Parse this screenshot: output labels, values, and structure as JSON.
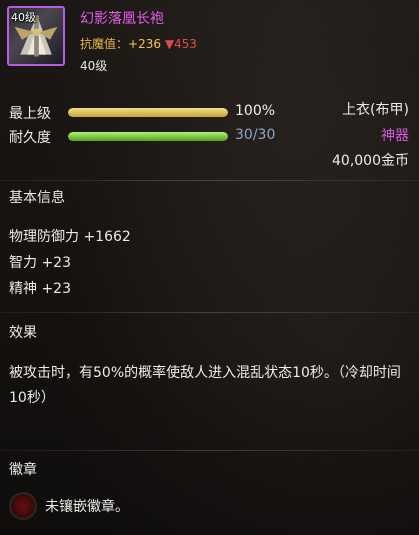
{
  "item": {
    "icon_level": "40级",
    "name": "幻影落凰长袍",
    "resist": {
      "label": "抗魔值：",
      "up": "+236",
      "down": "▼453"
    },
    "required_level": "40级"
  },
  "stats_top": {
    "grade_label": "最上级",
    "grade_percent": "100%",
    "grade_fill": 1.0,
    "durability_label": "耐久度",
    "durability_value": "30/30",
    "durability_fill": 1.0,
    "slot": "上衣(布甲)",
    "rarity": "神器",
    "price": "40,000金币"
  },
  "basic_info": {
    "title": "基本信息",
    "lines": [
      "物理防御力 +1662",
      "智力 +23",
      "精神 +23"
    ]
  },
  "effect": {
    "title": "效果",
    "text": "被攻击时，有50%的概率使敌人进入混乱状态10秒。（冷却时间10秒）"
  },
  "emblem": {
    "title": "徽章",
    "text": "未镶嵌徽章。"
  },
  "colors": {
    "name": "#e25de8",
    "rarity": "#d35be0",
    "resist_up": "#f2c94d",
    "resist_down": "#e34b4b",
    "grade_bar": "#e6c65c",
    "durability_bar": "#7bd03a"
  }
}
